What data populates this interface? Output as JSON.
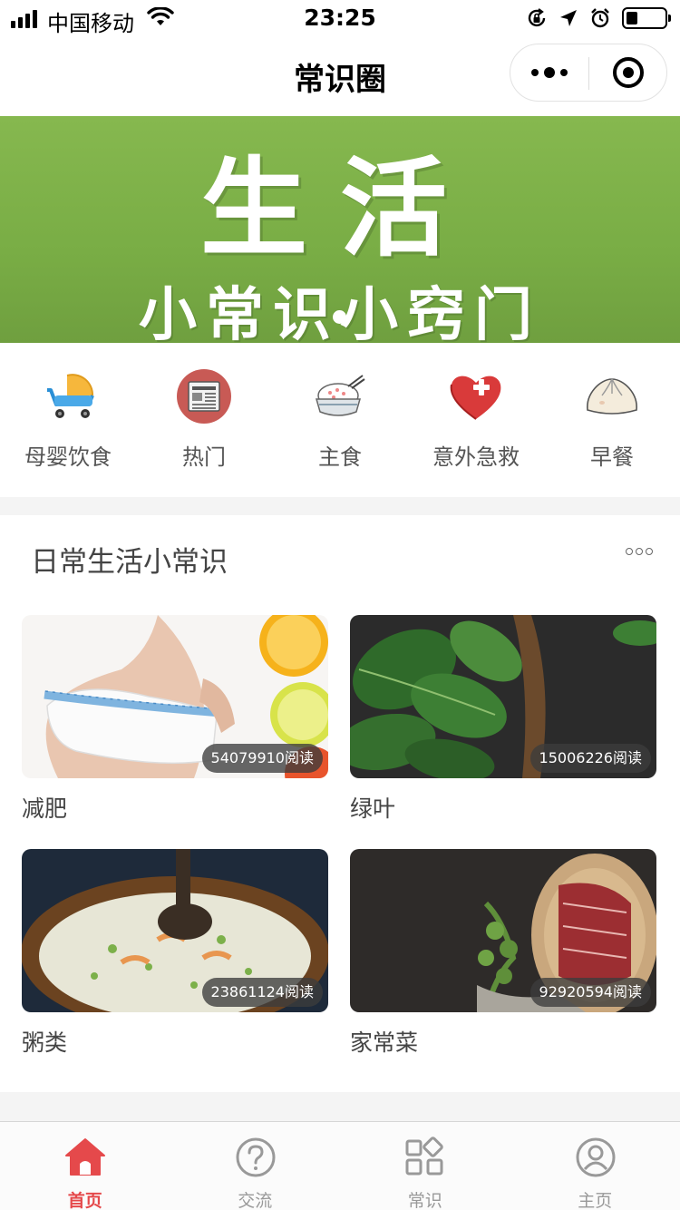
{
  "status_bar": {
    "carrier": "中国移动",
    "time": "23:25"
  },
  "nav": {
    "title": "常识圈"
  },
  "banner": {
    "headline": "生活",
    "subline": "小常识小窍门",
    "slide_count": 1,
    "active_slide": 1
  },
  "categories": [
    {
      "label": "母婴饮食",
      "icon": "stroller-icon"
    },
    {
      "label": "热门",
      "icon": "newspaper-icon"
    },
    {
      "label": "主食",
      "icon": "rice-bowl-icon"
    },
    {
      "label": "意外急救",
      "icon": "first-aid-heart-icon"
    },
    {
      "label": "早餐",
      "icon": "steamed-bun-icon"
    }
  ],
  "section": {
    "title": "日常生活小常识",
    "items": [
      {
        "label": "减肥",
        "reads": "54079910阅读"
      },
      {
        "label": "绿叶",
        "reads": "15006226阅读"
      },
      {
        "label": "粥类",
        "reads": "23861124阅读"
      },
      {
        "label": "家常菜",
        "reads": "92920594阅读"
      }
    ]
  },
  "tab_bar": {
    "accent_color": "#e5494b",
    "inactive_color": "#999999",
    "tabs": [
      {
        "label": "首页",
        "icon": "home-icon",
        "active": true
      },
      {
        "label": "交流",
        "icon": "question-icon",
        "active": false
      },
      {
        "label": "常识",
        "icon": "grid-icon",
        "active": false
      },
      {
        "label": "主页",
        "icon": "profile-icon",
        "active": false
      }
    ]
  }
}
